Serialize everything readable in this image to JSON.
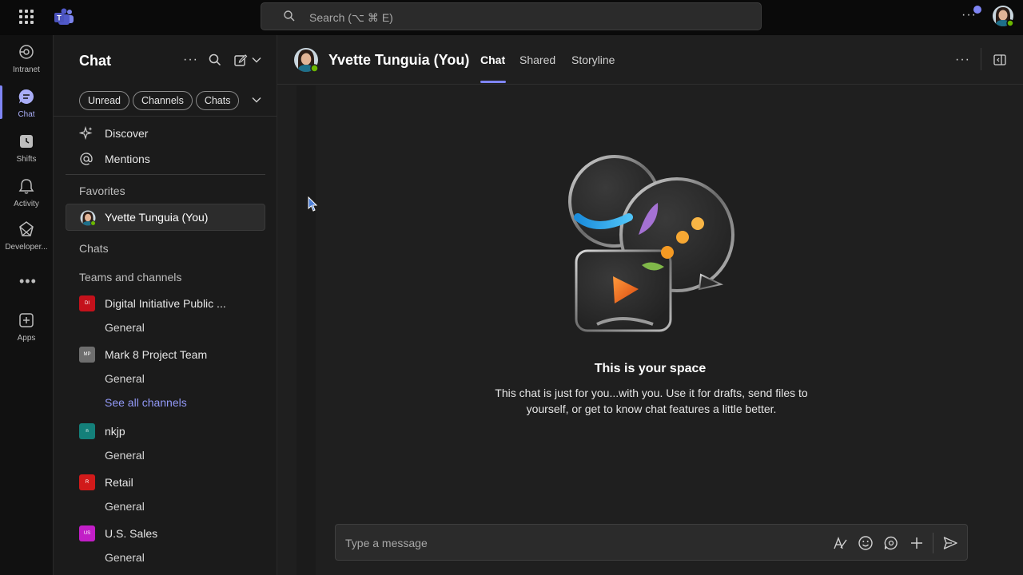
{
  "topbar": {
    "search_placeholder": "Search (⌥ ⌘ E)"
  },
  "rail": {
    "items": [
      {
        "label": "Intranet"
      },
      {
        "label": "Chat"
      },
      {
        "label": "Shifts"
      },
      {
        "label": "Activity"
      },
      {
        "label": "Developer..."
      },
      {
        "label": "Apps"
      }
    ]
  },
  "chat_list": {
    "title": "Chat",
    "filters": [
      "Unread",
      "Channels",
      "Chats"
    ],
    "quick_links": [
      {
        "label": "Discover",
        "icon": "sparkle-icon"
      },
      {
        "label": "Mentions",
        "icon": "at-icon"
      }
    ],
    "favorites_header": "Favorites",
    "favorite": {
      "name": "Yvette Tunguia (You)"
    },
    "chats_header": "Chats",
    "teams_header": "Teams and channels",
    "teams": [
      {
        "initials": "DI",
        "name": "Digital Initiative Public ...",
        "color": "#c4111b",
        "channel": "General"
      },
      {
        "initials": "MP",
        "name": "Mark 8 Project Team",
        "color": "#6e6e6e",
        "channel": "General"
      },
      {
        "initials": "n",
        "name": "nkjp",
        "color": "#14807a",
        "channel": "General"
      },
      {
        "initials": "R",
        "name": "Retail",
        "color": "#d11a1a",
        "channel": "General"
      },
      {
        "initials": "US",
        "name": "U.S. Sales",
        "color": "#c21ec7",
        "channel": "General"
      }
    ],
    "see_all": "See all channels"
  },
  "main": {
    "name": "Yvette Tunguia (You)",
    "tabs": [
      {
        "label": "Chat",
        "active": true
      },
      {
        "label": "Shared",
        "active": false
      },
      {
        "label": "Storyline",
        "active": false
      }
    ],
    "empty_title": "This is your space",
    "empty_desc": "This chat is just for you...with you. Use it for drafts, send files to yourself, or get to know chat features a little better.",
    "compose_placeholder": "Type a message"
  },
  "colors": {
    "accent": "#7f85f5",
    "presence": "#6bb700"
  }
}
